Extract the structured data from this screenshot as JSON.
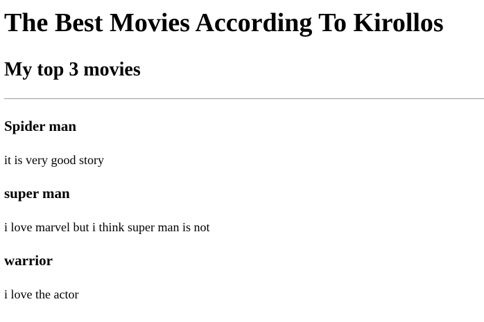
{
  "page": {
    "title": "The Best Movies According To Kirollos",
    "subtitle": "My top 3 movies"
  },
  "movies": [
    {
      "title": "Spider man",
      "description": "it is very good story"
    },
    {
      "title": "super man",
      "description": "i love marvel but i think super man is not"
    },
    {
      "title": "warrior",
      "description": "i love the actor"
    }
  ]
}
